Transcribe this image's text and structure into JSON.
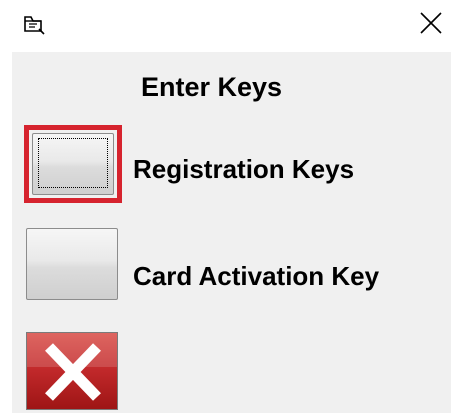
{
  "window": {
    "icon": "window-app-icon",
    "close_icon": "close-icon"
  },
  "dialog": {
    "heading": "Enter Keys"
  },
  "buttons": {
    "registration_label": "Registration Keys",
    "card_activation_label": "Card Activation Key",
    "cancel_icon": "red-x-icon"
  },
  "colors": {
    "focus_ring": "#d6232e",
    "cancel_bg": "#c0282a",
    "client_bg": "#f0f0f0"
  }
}
